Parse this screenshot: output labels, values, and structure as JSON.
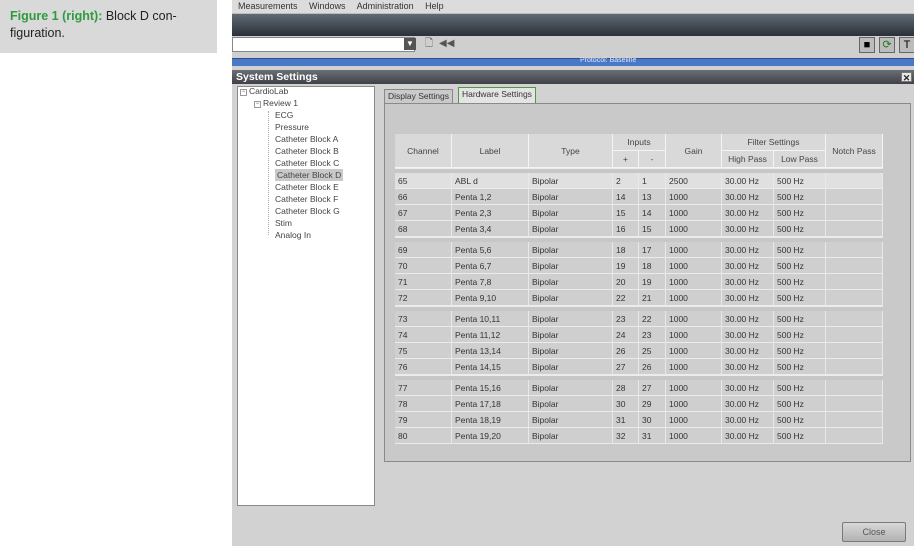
{
  "caption": {
    "fig_label": "Figure 1 (right):",
    "line1": " Block D con-",
    "line2": "figuration."
  },
  "menu": [
    "Measurements",
    "Windows",
    "Administration",
    "Help"
  ],
  "protocol_label": "Protocol: Baseline",
  "dialog_title": "System Settings",
  "tree": {
    "root": "CardioLab",
    "review": "Review 1",
    "items": [
      "ECG",
      "Pressure",
      "Catheter Block A",
      "Catheter Block B",
      "Catheter Block C",
      "Catheter Block D",
      "Catheter Block E",
      "Catheter Block F",
      "Catheter Block G",
      "Stim",
      "Analog In"
    ],
    "selected_index": 5
  },
  "tabs": [
    "Display Settings",
    "Hardware Settings"
  ],
  "active_tab": 1,
  "table": {
    "headers": {
      "channel": "Channel",
      "label": "Label",
      "type": "Type",
      "inputs": "Inputs",
      "plus": "+",
      "minus": "-",
      "gain": "Gain",
      "filter": "Filter Settings",
      "high_pass": "High Pass",
      "low_pass": "Low Pass",
      "notch": "Notch Pass"
    },
    "groups": [
      [
        [
          "65",
          "ABL d",
          "Bipolar",
          "2",
          "1",
          "2500",
          "30.00 Hz",
          "500 Hz",
          ""
        ],
        [
          "66",
          "Penta 1,2",
          "Bipolar",
          "14",
          "13",
          "1000",
          "30.00 Hz",
          "500 Hz",
          ""
        ],
        [
          "67",
          "Penta 2,3",
          "Bipolar",
          "15",
          "14",
          "1000",
          "30.00 Hz",
          "500 Hz",
          ""
        ],
        [
          "68",
          "Penta 3,4",
          "Bipolar",
          "16",
          "15",
          "1000",
          "30.00 Hz",
          "500 Hz",
          ""
        ]
      ],
      [
        [
          "69",
          "Penta 5,6",
          "Bipolar",
          "18",
          "17",
          "1000",
          "30.00 Hz",
          "500 Hz",
          ""
        ],
        [
          "70",
          "Penta 6,7",
          "Bipolar",
          "19",
          "18",
          "1000",
          "30.00 Hz",
          "500 Hz",
          ""
        ],
        [
          "71",
          "Penta 7,8",
          "Bipolar",
          "20",
          "19",
          "1000",
          "30.00 Hz",
          "500 Hz",
          ""
        ],
        [
          "72",
          "Penta 9,10",
          "Bipolar",
          "22",
          "21",
          "1000",
          "30.00 Hz",
          "500 Hz",
          ""
        ]
      ],
      [
        [
          "73",
          "Penta 10,11",
          "Bipolar",
          "23",
          "22",
          "1000",
          "30.00 Hz",
          "500 Hz",
          ""
        ],
        [
          "74",
          "Penta 11,12",
          "Bipolar",
          "24",
          "23",
          "1000",
          "30.00 Hz",
          "500 Hz",
          ""
        ],
        [
          "75",
          "Penta 13,14",
          "Bipolar",
          "26",
          "25",
          "1000",
          "30.00 Hz",
          "500 Hz",
          ""
        ],
        [
          "76",
          "Penta 14,15",
          "Bipolar",
          "27",
          "26",
          "1000",
          "30.00 Hz",
          "500 Hz",
          ""
        ]
      ],
      [
        [
          "77",
          "Penta 15,16",
          "Bipolar",
          "28",
          "27",
          "1000",
          "30.00 Hz",
          "500 Hz",
          ""
        ],
        [
          "78",
          "Penta 17,18",
          "Bipolar",
          "30",
          "29",
          "1000",
          "30.00 Hz",
          "500 Hz",
          ""
        ],
        [
          "79",
          "Penta 18,19",
          "Bipolar",
          "31",
          "30",
          "1000",
          "30.00 Hz",
          "500 Hz",
          ""
        ],
        [
          "80",
          "Penta 19,20",
          "Bipolar",
          "32",
          "31",
          "1000",
          "30.00 Hz",
          "500 Hz",
          ""
        ]
      ]
    ]
  },
  "close_label": "Close",
  "icons": {
    "tree_expand": "minus-box-icon",
    "dialog_close": "close-icon",
    "refresh": "refresh-icon"
  },
  "colors": {
    "caption_accent": "#2e9b3e",
    "active_tab_border": "#4d9a3f",
    "protocol_strip": "#4a78c4"
  }
}
